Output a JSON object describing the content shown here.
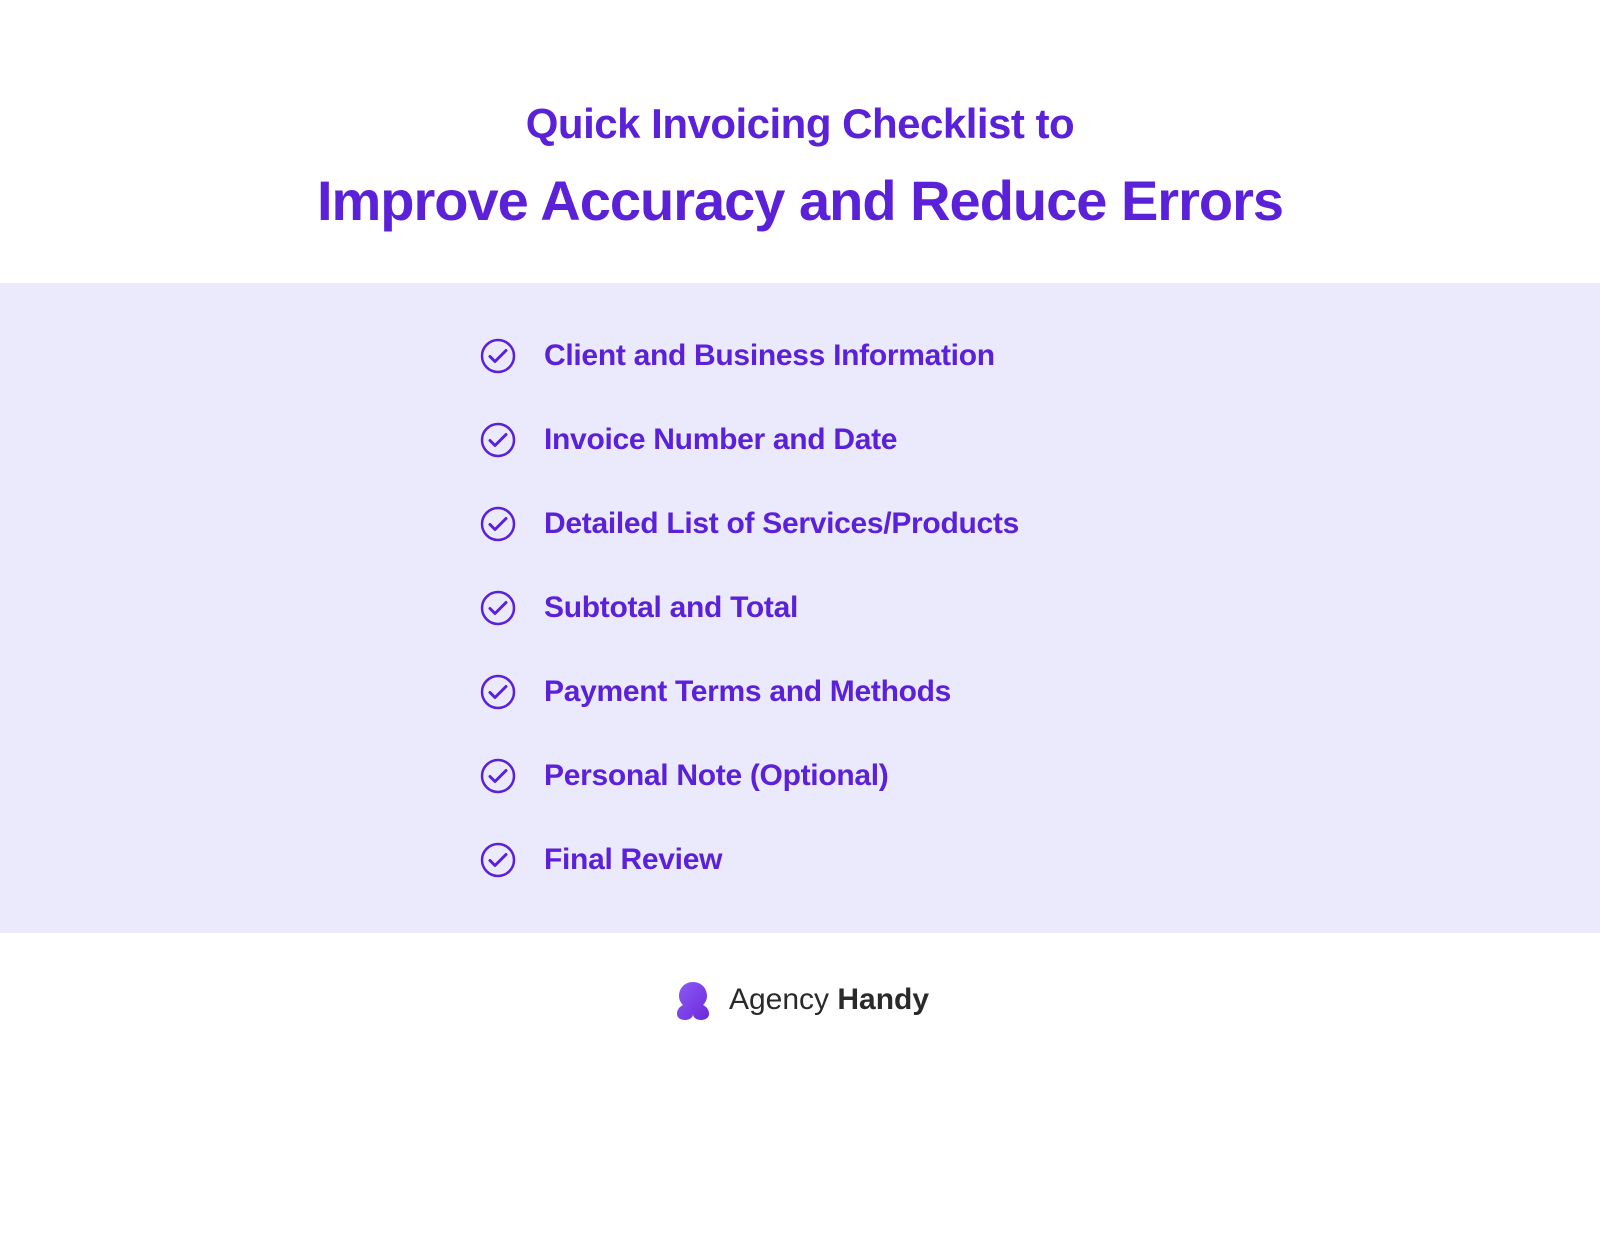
{
  "header": {
    "line1": "Quick Invoicing Checklist to",
    "line2": "Improve Accuracy and Reduce Errors"
  },
  "checklist": {
    "items": [
      {
        "label": "Client and Business Information"
      },
      {
        "label": "Invoice Number and Date"
      },
      {
        "label": "Detailed List of Services/Products"
      },
      {
        "label": "Subtotal and Total"
      },
      {
        "label": "Payment Terms and Methods"
      },
      {
        "label": "Personal Note (Optional)"
      },
      {
        "label": "Final Review"
      }
    ]
  },
  "footer": {
    "brand_text1": "Agency",
    "brand_text2": "Handy"
  },
  "colors": {
    "primary": "#5B21D9",
    "checklist_bg": "#EBE9FC",
    "white": "#ffffff"
  }
}
